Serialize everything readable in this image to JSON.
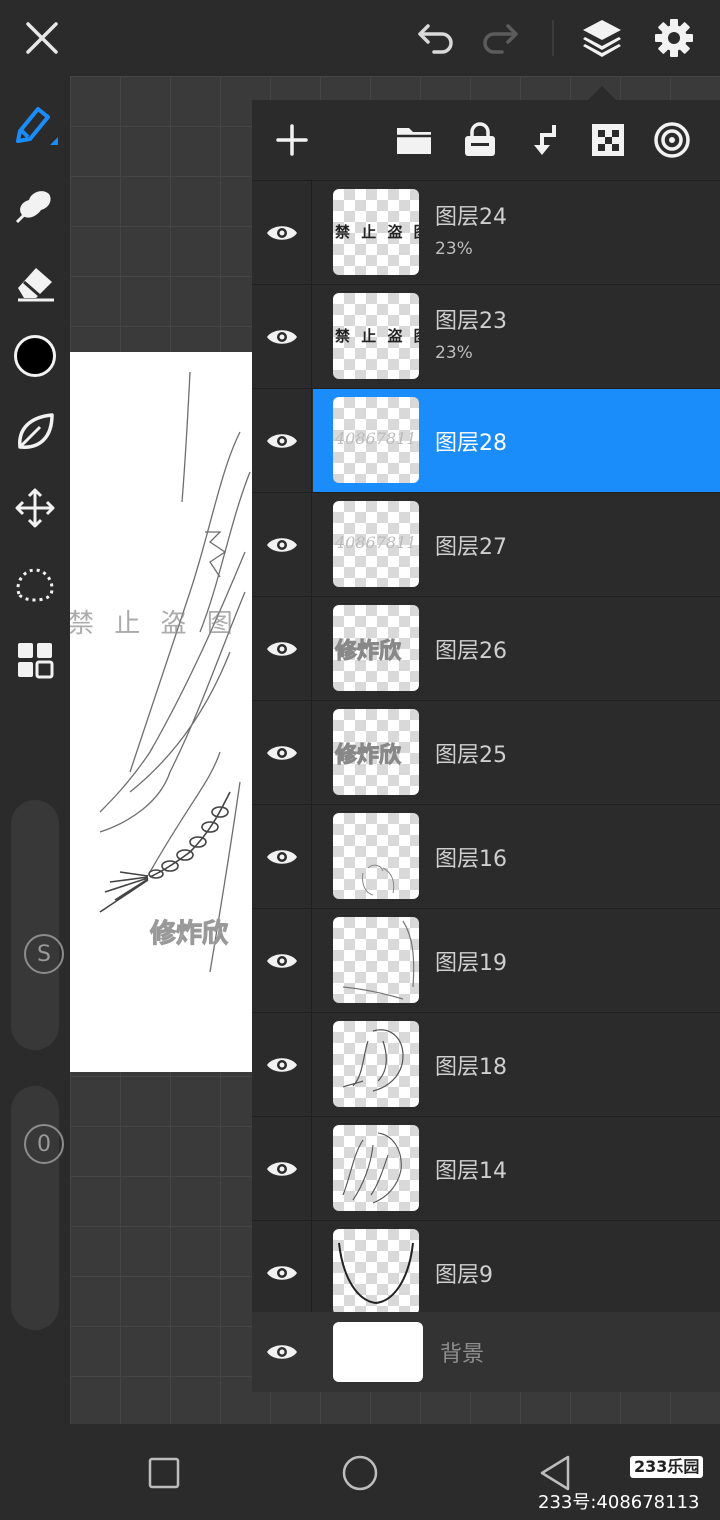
{
  "top_bar": {
    "close": "close-icon",
    "undo": "undo-icon",
    "redo": "redo-icon",
    "layers": "layers-icon",
    "settings": "gear-icon"
  },
  "tools": {
    "slider_size_label": "S",
    "slider_opacity_label": "0",
    "color": "#000000"
  },
  "canvas": {
    "wm_text": "禁 止 盗 图",
    "signature": "修炸欣"
  },
  "layers_panel": {
    "toolbar": [
      "add-icon",
      "folder-icon",
      "lock-icon",
      "merge-down-icon",
      "checker-icon",
      "spiral-icon"
    ],
    "layers": [
      {
        "name": "图层24",
        "opacity": "23%",
        "thumb_text": "禁 止 盗 图",
        "selected": false
      },
      {
        "name": "图层23",
        "opacity": "23%",
        "thumb_text": "禁 止 盗 图",
        "selected": false
      },
      {
        "name": "图层28",
        "opacity": "",
        "thumb_text": "40867811",
        "selected": true
      },
      {
        "name": "图层27",
        "opacity": "",
        "thumb_text": "40867811",
        "selected": false
      },
      {
        "name": "图层26",
        "opacity": "",
        "thumb_text": "修炸欣",
        "selected": false
      },
      {
        "name": "图层25",
        "opacity": "",
        "thumb_text": "修炸欣",
        "selected": false
      },
      {
        "name": "图层16",
        "opacity": "",
        "thumb_text": "",
        "selected": false
      },
      {
        "name": "图层19",
        "opacity": "",
        "thumb_text": "",
        "selected": false
      },
      {
        "name": "图层18",
        "opacity": "",
        "thumb_text": "",
        "selected": false
      },
      {
        "name": "图层14",
        "opacity": "",
        "thumb_text": "",
        "selected": false
      },
      {
        "name": "图层9",
        "opacity": "",
        "thumb_text": "",
        "selected": false
      }
    ],
    "background": {
      "name": "背景"
    }
  },
  "watermark": {
    "logo": "233乐园",
    "id_text": "233号:408678113"
  },
  "colors": {
    "accent": "#1b8dfb",
    "panel": "#2b2b2b"
  }
}
